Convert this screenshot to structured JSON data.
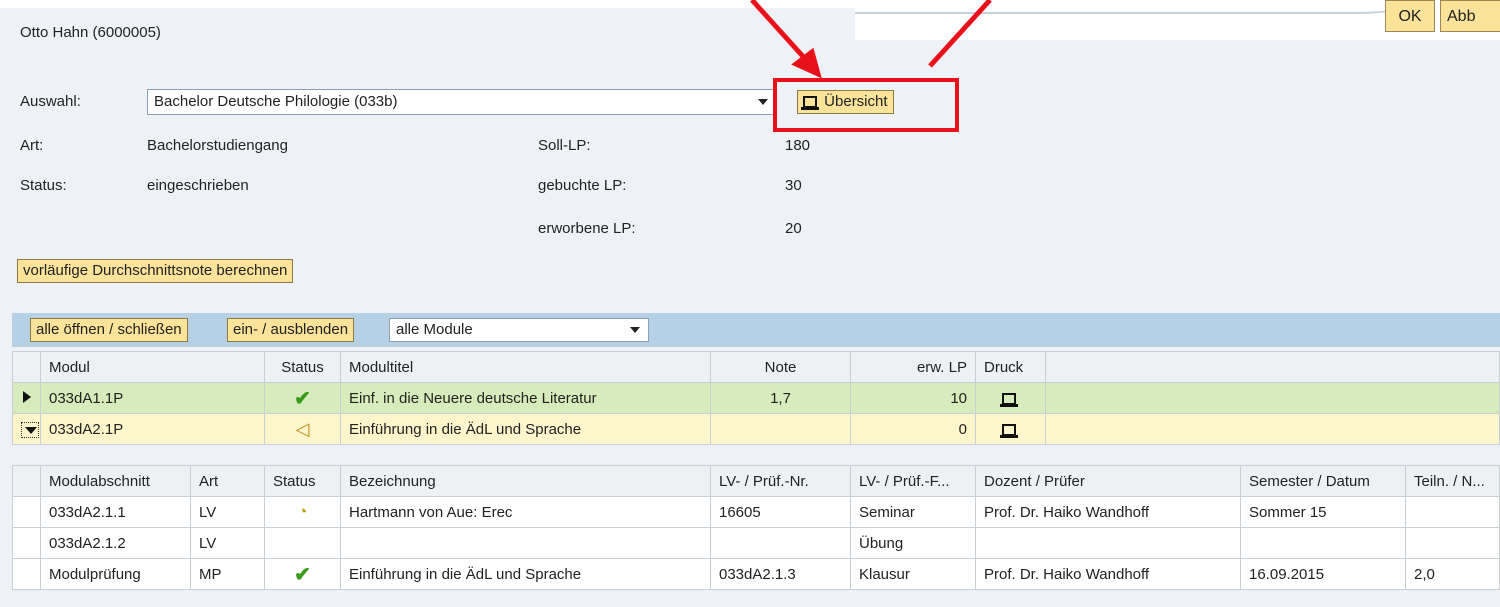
{
  "header": {
    "person": "Otto Hahn (6000005)",
    "ok_label": "OK",
    "abort_label": "Abb"
  },
  "selection": {
    "label": "Auswahl:",
    "value": "Bachelor Deutsche Philologie (033b)",
    "overview_label": "Übersicht"
  },
  "info": {
    "art_label": "Art:",
    "art_value": "Bachelorstudiengang",
    "status_label": "Status:",
    "status_value": "eingeschrieben",
    "soll_label": "Soll-LP:",
    "soll_value": "180",
    "gebucht_label": "gebuchte LP:",
    "gebucht_value": "30",
    "erworben_label": "erworbene LP:",
    "erworben_value": "20"
  },
  "calc_button": "vorläufige Durchschnittsnote berechnen",
  "toolbar": {
    "toggle_all": "alle öffnen / schließen",
    "show_hide": "ein- / ausblenden",
    "filter_value": "alle Module"
  },
  "modules": {
    "headers": [
      "Modul",
      "Status",
      "Modultitel",
      "Note",
      "erw. LP",
      "Druck"
    ],
    "rows": [
      {
        "code": "033dA1.1P",
        "status": "check",
        "title": "Einf. in die Neuere deutsche Literatur",
        "note": "1,7",
        "lp": "10"
      },
      {
        "code": "033dA2.1P",
        "status": "in-progress",
        "title": "Einführung in die ÄdL und Sprache",
        "note": "",
        "lp": "0"
      }
    ]
  },
  "sections": {
    "headers": [
      "Modulabschnitt",
      "Art",
      "Status",
      "Bezeichnung",
      "LV- / Prüf.-Nr.",
      "LV- / Prüf.-F...",
      "Dozent / Prüfer",
      "Semester / Datum",
      "Teiln. / N..."
    ],
    "rows": [
      {
        "abschnitt": "033dA2.1.1",
        "art": "LV",
        "status": "booked",
        "bez": "Hartmann von Aue: Erec",
        "nr": "16605",
        "form": "Seminar",
        "dozent": "Prof. Dr. Haiko Wandhoff",
        "sem": "Sommer 15",
        "teiln": ""
      },
      {
        "abschnitt": "033dA2.1.2",
        "art": "LV",
        "status": "",
        "bez": "",
        "nr": "",
        "form": "Übung",
        "dozent": "",
        "sem": "",
        "teiln": ""
      },
      {
        "abschnitt": "Modulprüfung",
        "art": "MP",
        "status": "check",
        "bez": "Einführung in die ÄdL und Sprache",
        "nr": "033dA2.1.3",
        "form": "Klausur",
        "dozent": "Prof. Dr. Haiko Wandhoff",
        "sem": "16.09.2015",
        "teiln": "2,0"
      }
    ]
  },
  "colors": {
    "annotation": "#e8101a",
    "button": "#fbe49a",
    "row_green": "#d7ecbc",
    "row_yellow": "#fdf6cc"
  }
}
